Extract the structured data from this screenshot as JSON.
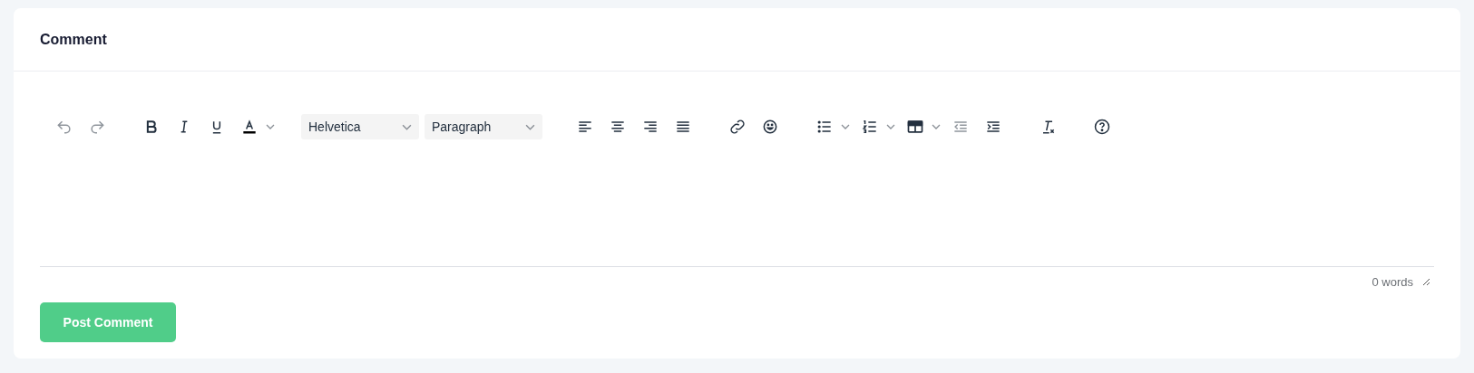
{
  "card": {
    "title": "Comment"
  },
  "toolbar": [
    {
      "items": [
        {
          "kind": "undo",
          "disabled": true
        },
        {
          "kind": "redo",
          "disabled": true
        }
      ]
    },
    {
      "items": [
        {
          "kind": "bold",
          "disabled": false
        },
        {
          "kind": "italic",
          "disabled": false
        },
        {
          "kind": "underline",
          "disabled": false
        },
        {
          "kind": "forecolor",
          "disabled": false
        }
      ]
    },
    {
      "items": [
        {
          "kind": "select",
          "value": "Helvetica"
        },
        {
          "kind": "select",
          "value": "Paragraph"
        }
      ]
    },
    {
      "items": [
        {
          "kind": "alignleft",
          "disabled": false
        },
        {
          "kind": "aligncenter",
          "disabled": false
        },
        {
          "kind": "alignright",
          "disabled": false
        },
        {
          "kind": "alignjustify",
          "disabled": false
        }
      ]
    },
    {
      "items": [
        {
          "kind": "link",
          "disabled": false
        },
        {
          "kind": "emoji",
          "disabled": false
        }
      ]
    },
    {
      "items": [
        {
          "kind": "bullist",
          "disabled": false
        },
        {
          "kind": "numlist",
          "disabled": false
        },
        {
          "kind": "table",
          "disabled": false
        },
        {
          "kind": "outdent",
          "disabled": true
        },
        {
          "kind": "indent",
          "disabled": false
        }
      ]
    },
    {
      "items": [
        {
          "kind": "removeformat",
          "disabled": false
        }
      ]
    },
    {
      "items": [
        {
          "kind": "help",
          "disabled": false
        }
      ]
    }
  ],
  "status": {
    "word_count": "0 words"
  },
  "submit": {
    "label": "Post Comment"
  }
}
